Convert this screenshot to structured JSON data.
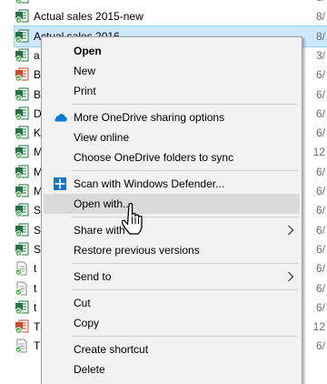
{
  "files": [
    {
      "name": "",
      "date": "8/",
      "icon": "excel-sync-icon"
    },
    {
      "name": "Actual sales 2015-new",
      "date": "8/",
      "icon": "excel-sync-icon"
    },
    {
      "name": "Actual sales 2016",
      "date": "8/",
      "icon": "excel-sync-icon",
      "selected": true
    },
    {
      "name": "a",
      "date": "3/",
      "icon": "excel-sync-icon"
    },
    {
      "name": "B",
      "date": "6/",
      "icon": "powerpoint-sync-icon"
    },
    {
      "name": "B",
      "date": "6/",
      "icon": "excel-sync-icon"
    },
    {
      "name": "D",
      "date": "6/",
      "icon": "excel-sync-icon"
    },
    {
      "name": "K",
      "date": "6/",
      "icon": "excel-sync-icon"
    },
    {
      "name": "M",
      "date": "12",
      "icon": "excel-sync-icon"
    },
    {
      "name": "M",
      "date": "6/",
      "icon": "excel-sync-icon"
    },
    {
      "name": "M",
      "date": "6/",
      "icon": "excel-sync-icon"
    },
    {
      "name": "S",
      "date": "6/",
      "icon": "excel-sync-icon"
    },
    {
      "name": "S",
      "date": "6/",
      "icon": "excel-sync-icon"
    },
    {
      "name": "S",
      "date": "6/",
      "icon": "excel-sync-icon"
    },
    {
      "name": "t",
      "date": "6/",
      "icon": "text-file-icon"
    },
    {
      "name": "t",
      "date": "6/",
      "icon": "text-file-icon"
    },
    {
      "name": "t",
      "date": "6/",
      "icon": "excel-sync-icon"
    },
    {
      "name": "T",
      "date": "12",
      "icon": "powerpoint-sync-icon"
    },
    {
      "name": "T",
      "date": "6/",
      "icon": "text-file-icon"
    }
  ],
  "context_menu": {
    "open": "Open",
    "new": "New",
    "print": "Print",
    "onedrive_share": "More OneDrive sharing options",
    "view_online": "View online",
    "choose_folders": "Choose OneDrive folders to sync",
    "scan_defender": "Scan with Windows Defender...",
    "open_with": "Open with...",
    "share_with": "Share with",
    "restore_versions": "Restore previous versions",
    "send_to": "Send to",
    "cut": "Cut",
    "copy": "Copy",
    "create_shortcut": "Create shortcut",
    "delete": "Delete"
  },
  "icons": {
    "onedrive": "cloud-icon",
    "defender": "shield-icon",
    "submenu": "chevron-right-icon",
    "pointer": "hand-pointer-icon"
  },
  "colors": {
    "excel_green": "#217346",
    "sync_green": "#4caf50",
    "powerpoint_red": "#d24726",
    "onedrive_blue": "#0078d7",
    "selection": "#cce8ff",
    "hover": "#dadada",
    "menu_bg": "#f2f2f2"
  }
}
